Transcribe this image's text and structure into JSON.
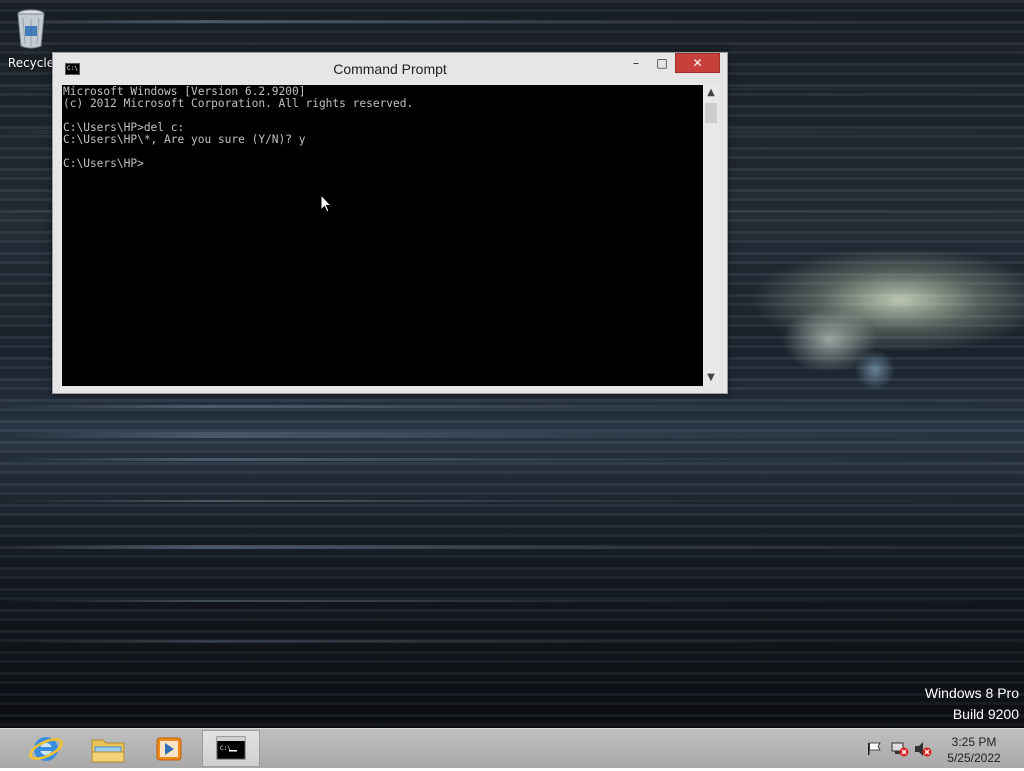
{
  "desktop": {
    "recycle_bin_label": "Recycle",
    "watermark": {
      "line1": "Windows 8 Pro",
      "line2": "Build 9200"
    }
  },
  "window": {
    "title": "Command Prompt",
    "icon": "cmd-icon",
    "buttons": {
      "minimize": "–",
      "maximize": "□",
      "close": "✕"
    },
    "console_lines": [
      "Microsoft Windows [Version 6.2.9200]",
      "(c) 2012 Microsoft Corporation. All rights reserved.",
      "",
      "C:\\Users\\HP>del c:",
      "C:\\Users\\HP\\*, Are you sure (Y/N)? y",
      "",
      "C:\\Users\\HP>"
    ]
  },
  "taskbar": {
    "items": [
      {
        "name": "internet-explorer",
        "icon": "ie-icon"
      },
      {
        "name": "file-explorer",
        "icon": "folder-icon"
      },
      {
        "name": "media-player",
        "icon": "media-icon"
      },
      {
        "name": "command-prompt",
        "icon": "cmd-icon",
        "active": true
      }
    ],
    "tray_icons": [
      "flag-icon",
      "network-error-icon",
      "volume-muted-icon"
    ],
    "clock": {
      "time": "3:25 PM",
      "date": "5/25/2022"
    }
  }
}
